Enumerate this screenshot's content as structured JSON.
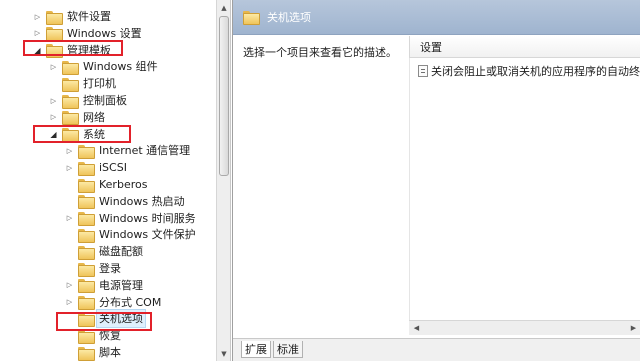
{
  "tree": {
    "items": [
      {
        "label": "软件设置",
        "toggle": "collapsed"
      },
      {
        "label": "Windows 设置",
        "toggle": "collapsed"
      },
      {
        "label": "管理模板",
        "toggle": "expanded"
      },
      {
        "label": "Windows 组件",
        "toggle": "collapsed"
      },
      {
        "label": "打印机",
        "toggle": "none"
      },
      {
        "label": "控制面板",
        "toggle": "collapsed"
      },
      {
        "label": "网络",
        "toggle": "collapsed"
      },
      {
        "label": "系统",
        "toggle": "expanded"
      },
      {
        "label": "Internet 通信管理",
        "toggle": "collapsed"
      },
      {
        "label": "iSCSI",
        "toggle": "collapsed"
      },
      {
        "label": "Kerberos",
        "toggle": "none"
      },
      {
        "label": "Windows 热启动",
        "toggle": "none"
      },
      {
        "label": "Windows 时间服务",
        "toggle": "collapsed"
      },
      {
        "label": "Windows 文件保护",
        "toggle": "none"
      },
      {
        "label": "磁盘配额",
        "toggle": "none"
      },
      {
        "label": "登录",
        "toggle": "none"
      },
      {
        "label": "电源管理",
        "toggle": "collapsed"
      },
      {
        "label": "分布式 COM",
        "toggle": "collapsed"
      },
      {
        "label": "关机选项",
        "toggle": "none",
        "selected": true
      },
      {
        "label": "恢复",
        "toggle": "none"
      },
      {
        "label": "脚本",
        "toggle": "none"
      }
    ]
  },
  "right": {
    "header_title": "关机选项",
    "description": "选择一个项目来查看它的描述。",
    "settings_header": "设置",
    "settings": [
      {
        "label": "关闭会阻止或取消关机的应用程序的自动终止功能"
      }
    ]
  },
  "tabs": [
    {
      "label": "扩展",
      "active": true
    },
    {
      "label": "标准",
      "active": false
    }
  ],
  "colors": {
    "highlight_box": "#e2212a",
    "header_bar": "#a9bcd6",
    "selection": "#dff0fd"
  },
  "icons": {
    "folder": "folder-icon",
    "expand": "triangle-right-icon",
    "collapse": "triangle-down-icon",
    "policy": "policy-setting-icon"
  }
}
